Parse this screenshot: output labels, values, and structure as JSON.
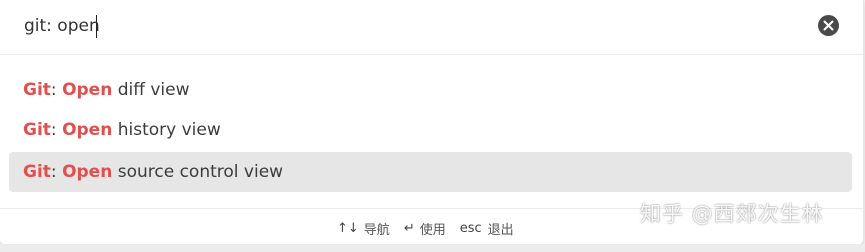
{
  "search": {
    "value": "git: open",
    "clear_icon": "close-circle-icon"
  },
  "results": [
    {
      "prefix": "Git",
      "separator": ":",
      "match": "Open",
      "rest": " diff view",
      "selected": false
    },
    {
      "prefix": "Git",
      "separator": ":",
      "match": "Open",
      "rest": " history view",
      "selected": false
    },
    {
      "prefix": "Git",
      "separator": ":",
      "match": "Open",
      "rest": " source control view",
      "selected": true
    }
  ],
  "footer": {
    "navigate_key": "↑↓",
    "navigate_label": "导航",
    "use_key": "↵",
    "use_label": "使用",
    "esc_key": "esc",
    "esc_label": "退出"
  },
  "watermark": "知乎 @西郊次生林",
  "colors": {
    "highlight": "#e0504f",
    "selected_bg": "#e6e6e6"
  }
}
